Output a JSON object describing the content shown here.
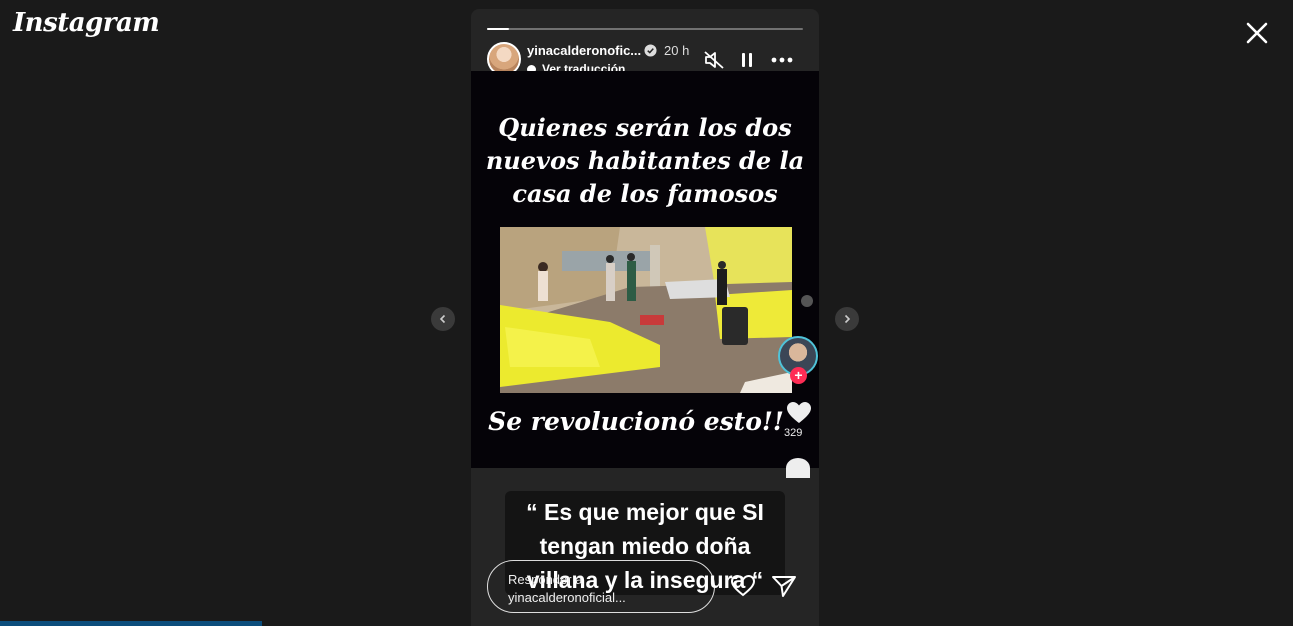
{
  "app": {
    "logo_text": "Instagram"
  },
  "story": {
    "progress_fraction": 0.07,
    "username": "yinacalderonofic...",
    "time": "20 h",
    "translate_label": "Ver traducción",
    "media": {
      "headline": "Quienes serán los dos nuevos habitantes de la casa de los famosos",
      "bottom_caption": "Se revolucionó esto!!",
      "like_count": "329"
    },
    "quote_text": "“ Es que mejor que SI tengan miedo doña villana y la insegura “",
    "reply_placeholder": "Responder a yinacalderonoficial..."
  },
  "colors": {
    "background": "#1a1a1a",
    "story_bg": "#252525",
    "accent_plus": "#fe2c55"
  }
}
